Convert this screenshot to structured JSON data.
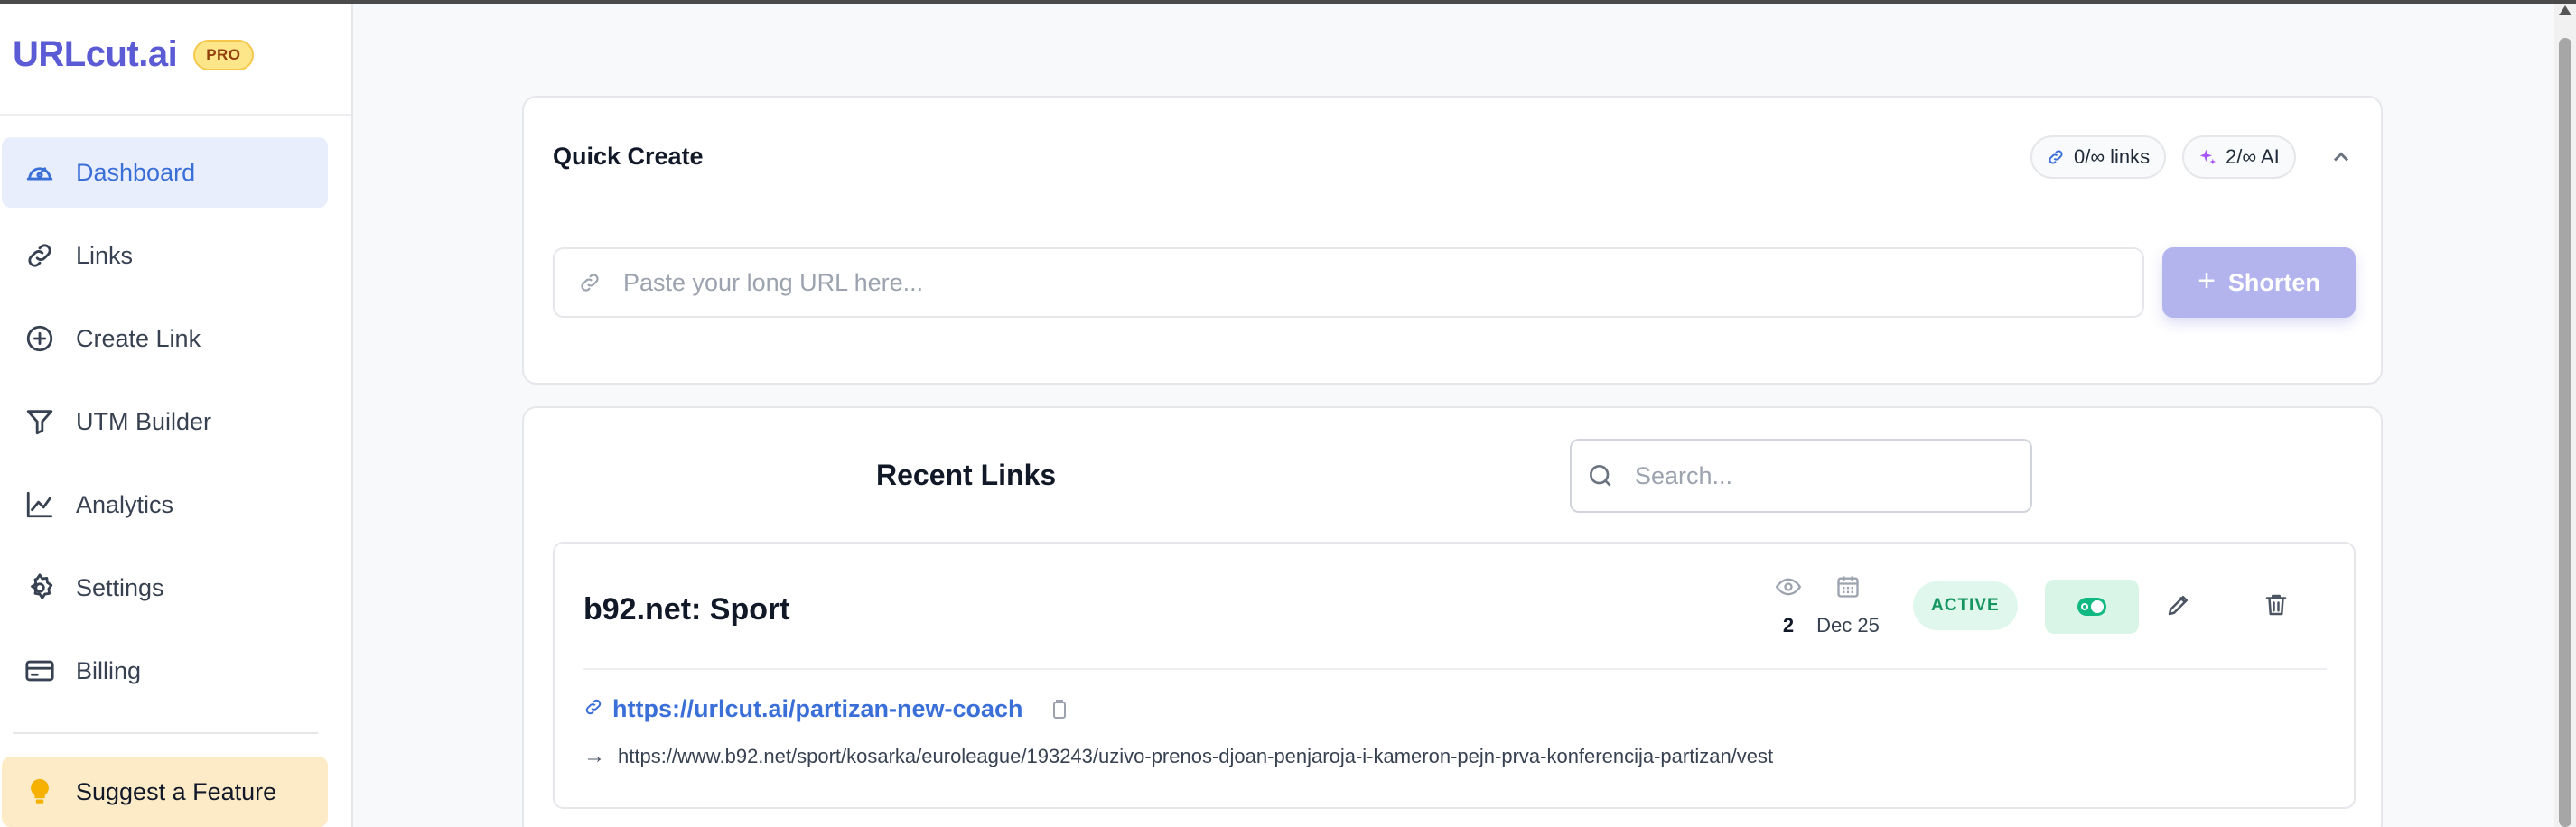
{
  "brand": {
    "name": "URLcut.ai",
    "badge": "PRO"
  },
  "sidebar": {
    "items": [
      {
        "label": "Dashboard",
        "icon": "gauge-icon",
        "active": true
      },
      {
        "label": "Links",
        "icon": "link-icon"
      },
      {
        "label": "Create Link",
        "icon": "plus-circle-icon"
      },
      {
        "label": "UTM Builder",
        "icon": "filter-icon"
      },
      {
        "label": "Analytics",
        "icon": "line-chart-icon"
      },
      {
        "label": "Settings",
        "icon": "gear-icon"
      },
      {
        "label": "Billing",
        "icon": "credit-card-icon"
      }
    ],
    "suggest": {
      "label": "Suggest a Feature",
      "icon": "lightbulb-icon"
    }
  },
  "quick_create": {
    "title": "Quick Create",
    "links_quota": "0/∞ links",
    "ai_quota": "2/∞ AI",
    "url_placeholder": "Paste your long URL here...",
    "url_value": "",
    "shorten_label": "Shorten"
  },
  "recent_links": {
    "title": "Recent Links",
    "search_placeholder": "Search...",
    "items": [
      {
        "title": "b92.net: Sport",
        "views": "2",
        "date": "Dec 25",
        "status": "ACTIVE",
        "short_url": "https://urlcut.ai/partizan-new-coach",
        "destination": "https://www.b92.net/sport/kosarka/euroleague/193243/uzivo-prenos-djoan-penjaroja-i-kameron-pejn-prva-konferencija-partizan/vest"
      }
    ]
  },
  "colors": {
    "brand": "#5b5bd6",
    "active_nav_bg": "#e8eefc",
    "accent_link": "#3b6fd8",
    "shorten_button": "#b3b4ee",
    "status_active": "#15955f",
    "suggest_bg": "#fdebc8"
  }
}
